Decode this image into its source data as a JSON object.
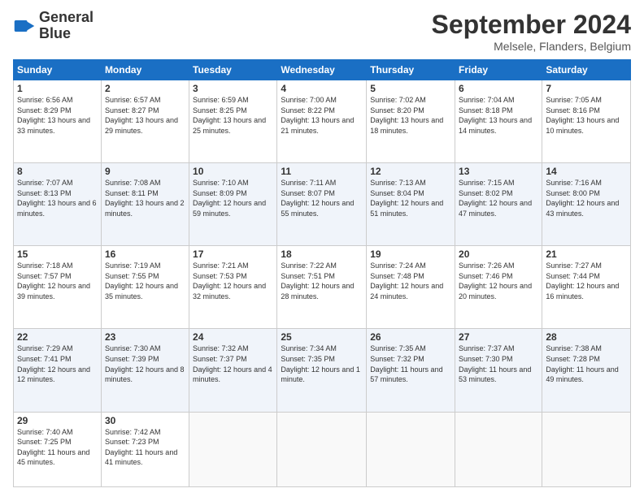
{
  "logo": {
    "line1": "General",
    "line2": "Blue"
  },
  "header": {
    "month": "September 2024",
    "location": "Melsele, Flanders, Belgium"
  },
  "days": [
    "Sunday",
    "Monday",
    "Tuesday",
    "Wednesday",
    "Thursday",
    "Friday",
    "Saturday"
  ],
  "weeks": [
    [
      {
        "num": "1",
        "rise": "6:56 AM",
        "set": "8:29 PM",
        "daylight": "13 hours and 33 minutes."
      },
      {
        "num": "2",
        "rise": "6:57 AM",
        "set": "8:27 PM",
        "daylight": "13 hours and 29 minutes."
      },
      {
        "num": "3",
        "rise": "6:59 AM",
        "set": "8:25 PM",
        "daylight": "13 hours and 25 minutes."
      },
      {
        "num": "4",
        "rise": "7:00 AM",
        "set": "8:22 PM",
        "daylight": "13 hours and 21 minutes."
      },
      {
        "num": "5",
        "rise": "7:02 AM",
        "set": "8:20 PM",
        "daylight": "13 hours and 18 minutes."
      },
      {
        "num": "6",
        "rise": "7:04 AM",
        "set": "8:18 PM",
        "daylight": "13 hours and 14 minutes."
      },
      {
        "num": "7",
        "rise": "7:05 AM",
        "set": "8:16 PM",
        "daylight": "13 hours and 10 minutes."
      }
    ],
    [
      {
        "num": "8",
        "rise": "7:07 AM",
        "set": "8:13 PM",
        "daylight": "13 hours and 6 minutes."
      },
      {
        "num": "9",
        "rise": "7:08 AM",
        "set": "8:11 PM",
        "daylight": "13 hours and 2 minutes."
      },
      {
        "num": "10",
        "rise": "7:10 AM",
        "set": "8:09 PM",
        "daylight": "12 hours and 59 minutes."
      },
      {
        "num": "11",
        "rise": "7:11 AM",
        "set": "8:07 PM",
        "daylight": "12 hours and 55 minutes."
      },
      {
        "num": "12",
        "rise": "7:13 AM",
        "set": "8:04 PM",
        "daylight": "12 hours and 51 minutes."
      },
      {
        "num": "13",
        "rise": "7:15 AM",
        "set": "8:02 PM",
        "daylight": "12 hours and 47 minutes."
      },
      {
        "num": "14",
        "rise": "7:16 AM",
        "set": "8:00 PM",
        "daylight": "12 hours and 43 minutes."
      }
    ],
    [
      {
        "num": "15",
        "rise": "7:18 AM",
        "set": "7:57 PM",
        "daylight": "12 hours and 39 minutes."
      },
      {
        "num": "16",
        "rise": "7:19 AM",
        "set": "7:55 PM",
        "daylight": "12 hours and 35 minutes."
      },
      {
        "num": "17",
        "rise": "7:21 AM",
        "set": "7:53 PM",
        "daylight": "12 hours and 32 minutes."
      },
      {
        "num": "18",
        "rise": "7:22 AM",
        "set": "7:51 PM",
        "daylight": "12 hours and 28 minutes."
      },
      {
        "num": "19",
        "rise": "7:24 AM",
        "set": "7:48 PM",
        "daylight": "12 hours and 24 minutes."
      },
      {
        "num": "20",
        "rise": "7:26 AM",
        "set": "7:46 PM",
        "daylight": "12 hours and 20 minutes."
      },
      {
        "num": "21",
        "rise": "7:27 AM",
        "set": "7:44 PM",
        "daylight": "12 hours and 16 minutes."
      }
    ],
    [
      {
        "num": "22",
        "rise": "7:29 AM",
        "set": "7:41 PM",
        "daylight": "12 hours and 12 minutes."
      },
      {
        "num": "23",
        "rise": "7:30 AM",
        "set": "7:39 PM",
        "daylight": "12 hours and 8 minutes."
      },
      {
        "num": "24",
        "rise": "7:32 AM",
        "set": "7:37 PM",
        "daylight": "12 hours and 4 minutes."
      },
      {
        "num": "25",
        "rise": "7:34 AM",
        "set": "7:35 PM",
        "daylight": "12 hours and 1 minute."
      },
      {
        "num": "26",
        "rise": "7:35 AM",
        "set": "7:32 PM",
        "daylight": "11 hours and 57 minutes."
      },
      {
        "num": "27",
        "rise": "7:37 AM",
        "set": "7:30 PM",
        "daylight": "11 hours and 53 minutes."
      },
      {
        "num": "28",
        "rise": "7:38 AM",
        "set": "7:28 PM",
        "daylight": "11 hours and 49 minutes."
      }
    ],
    [
      {
        "num": "29",
        "rise": "7:40 AM",
        "set": "7:25 PM",
        "daylight": "11 hours and 45 minutes."
      },
      {
        "num": "30",
        "rise": "7:42 AM",
        "set": "7:23 PM",
        "daylight": "11 hours and 41 minutes."
      },
      null,
      null,
      null,
      null,
      null
    ]
  ]
}
